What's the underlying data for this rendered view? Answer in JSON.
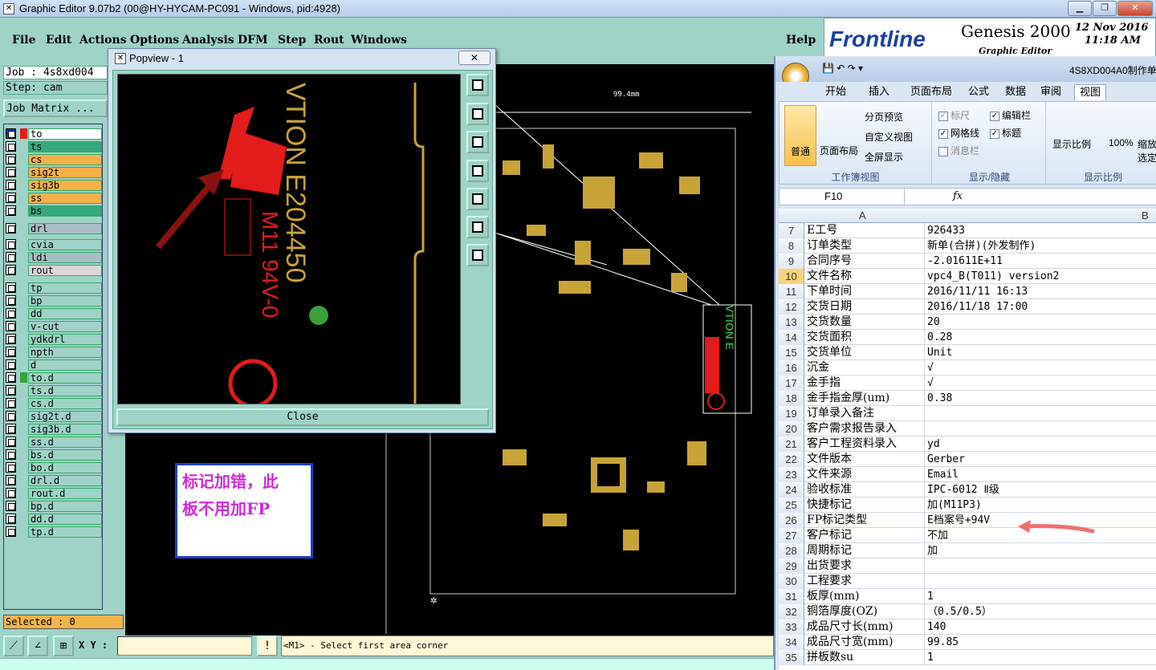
{
  "window": {
    "title": "Graphic Editor 9.07b2 (00@HY-HYCAM-PC091 - Windows, pid:4928)"
  },
  "menu": [
    "File",
    "Edit",
    "Actions",
    "Options",
    "Analysis",
    "DFM",
    "Step",
    "Rout",
    "Windows"
  ],
  "help": "Help",
  "logo": {
    "brand": "Frontline",
    "product": "Genesis 2000",
    "sub": "Graphic Editor",
    "date": "12 Nov 2016",
    "time": "11:18 AM"
  },
  "job": {
    "job": "Job : 4s8xd004",
    "step": "Step: cam",
    "matrix": "Job Matrix ..."
  },
  "layers": [
    {
      "name": "to",
      "bg": "#ffffff",
      "swatch": "#e21b1b",
      "sel": true
    },
    {
      "name": "ts",
      "bg": "#35a87c",
      "swatch": "",
      "sel": false
    },
    {
      "name": "cs",
      "bg": "#f5b04a",
      "swatch": "",
      "sel": false
    },
    {
      "name": "sig2t",
      "bg": "#f5b04a",
      "swatch": "",
      "sel": false
    },
    {
      "name": "sig3b",
      "bg": "#f5b04a",
      "swatch": "",
      "sel": false
    },
    {
      "name": "ss",
      "bg": "#f5b04a",
      "swatch": "",
      "sel": false
    },
    {
      "name": "bs",
      "bg": "#35a87c",
      "swatch": "",
      "sel": false
    },
    {
      "name": "drl",
      "bg": "#a9bec4",
      "swatch": "",
      "sel": false
    },
    {
      "name": "cvia",
      "bg": "#9fd3c7",
      "swatch": "",
      "sel": false
    },
    {
      "name": "ldi",
      "bg": "#a9bec4",
      "swatch": "",
      "sel": false
    },
    {
      "name": "rout",
      "bg": "#d9d9d9",
      "swatch": "",
      "sel": false
    },
    {
      "name": "tp",
      "bg": "#9fd3c7",
      "swatch": "",
      "sel": false
    },
    {
      "name": "bp",
      "bg": "#9fd3c7",
      "swatch": "",
      "sel": false
    },
    {
      "name": "dd",
      "bg": "#9fd3c7",
      "swatch": "",
      "sel": false
    },
    {
      "name": "v-cut",
      "bg": "#9fd3c7",
      "swatch": "",
      "sel": false
    },
    {
      "name": "ydkdrl",
      "bg": "#9fd3c7",
      "swatch": "",
      "sel": false
    },
    {
      "name": "npth",
      "bg": "#9fd3c7",
      "swatch": "",
      "sel": false
    },
    {
      "name": "d",
      "bg": "#9fd3c7",
      "swatch": "",
      "sel": false
    },
    {
      "name": "to.d",
      "bg": "#9fd3c7",
      "swatch": "#3aa03a",
      "sel": false
    },
    {
      "name": "ts.d",
      "bg": "#9fd3c7",
      "swatch": "",
      "sel": false
    },
    {
      "name": "cs.d",
      "bg": "#9fd3c7",
      "swatch": "",
      "sel": false
    },
    {
      "name": "sig2t.d",
      "bg": "#9fd3c7",
      "swatch": "",
      "sel": false
    },
    {
      "name": "sig3b.d",
      "bg": "#9fd3c7",
      "swatch": "",
      "sel": false
    },
    {
      "name": "ss.d",
      "bg": "#9fd3c7",
      "swatch": "",
      "sel": false
    },
    {
      "name": "bs.d",
      "bg": "#9fd3c7",
      "swatch": "",
      "sel": false
    },
    {
      "name": "bo.d",
      "bg": "#9fd3c7",
      "swatch": "",
      "sel": false
    },
    {
      "name": "drl.d",
      "bg": "#9fd3c7",
      "swatch": "",
      "sel": false
    },
    {
      "name": "rout.d",
      "bg": "#9fd3c7",
      "swatch": "",
      "sel": false
    },
    {
      "name": "bp.d",
      "bg": "#9fd3c7",
      "swatch": "",
      "sel": false
    },
    {
      "name": "dd.d",
      "bg": "#9fd3c7",
      "swatch": "",
      "sel": false
    },
    {
      "name": "tp.d",
      "bg": "#9fd3c7",
      "swatch": "",
      "sel": false
    }
  ],
  "selected": "Selected : 0",
  "popview": {
    "title": "Popview - 1",
    "close": "Close",
    "marking_text": "VTION E204450",
    "marking_line2": "M11 94V-0"
  },
  "canvas": {
    "dim": "99.4mm",
    "board_mark": "VTION E"
  },
  "note": {
    "line1": "标记加错，此",
    "line2": "板不用加FP"
  },
  "bottom": {
    "xy_label": "X Y :",
    "prompt": "<M1> - Select first area corner"
  },
  "excel": {
    "title": "4S8XD004A0制作单",
    "tabs": [
      "开始",
      "插入",
      "页面布局",
      "公式",
      "数据",
      "审阅",
      "视图"
    ],
    "active_tab": "视图",
    "ribbon": {
      "normal": "普通",
      "page_layout": "页面布局",
      "page_break": "分页预览",
      "custom_view": "自定义视图",
      "full_screen": "全屏显示",
      "group1": "工作簿视图",
      "ruler": "标尺",
      "formula_bar": "编辑栏",
      "gridlines": "网格线",
      "headings": "标题",
      "message_bar": "消息栏",
      "group2": "显示/隐藏",
      "zoom": "显示比例",
      "zoom100": "100%",
      "zoom_sel": "缩放到选定区域",
      "group3": "显示比例"
    },
    "namebox": "F10",
    "fx": "fx",
    "col_a": "A",
    "col_b": "B",
    "rows": [
      {
        "n": "7",
        "a": "E工号",
        "b": "926433"
      },
      {
        "n": "8",
        "a": "订单类型",
        "b": "新单(合拼)(外发制作)"
      },
      {
        "n": "9",
        "a": "合同序号",
        "b": "-2.01611E+11"
      },
      {
        "n": "10",
        "a": "文件名称",
        "b": "vpc4_B(T011) version2"
      },
      {
        "n": "11",
        "a": "下单时间",
        "b": "2016/11/11 16:13"
      },
      {
        "n": "12",
        "a": "交货日期",
        "b": "2016/11/18 17:00"
      },
      {
        "n": "13",
        "a": "交货数量",
        "b": "20"
      },
      {
        "n": "14",
        "a": "交货面积",
        "b": "0.28"
      },
      {
        "n": "15",
        "a": "交货单位",
        "b": "Unit"
      },
      {
        "n": "16",
        "a": "沉金",
        "b": "√"
      },
      {
        "n": "17",
        "a": "金手指",
        "b": "√"
      },
      {
        "n": "18",
        "a": "金手指金厚(um)",
        "b": "0.38"
      },
      {
        "n": "19",
        "a": "订单录入备注",
        "b": ""
      },
      {
        "n": "20",
        "a": "客户需求报告录入",
        "b": ""
      },
      {
        "n": "21",
        "a": "客户工程资料录入",
        "b": "yd"
      },
      {
        "n": "22",
        "a": "文件版本",
        "b": "Gerber"
      },
      {
        "n": "23",
        "a": "文件来源",
        "b": "Email"
      },
      {
        "n": "24",
        "a": "验收标准",
        "b": "IPC-6012 Ⅱ级"
      },
      {
        "n": "25",
        "a": "快捷标记",
        "b": "加(M11P3)"
      },
      {
        "n": "26",
        "a": "FP标记类型",
        "b": "E档案号+94V"
      },
      {
        "n": "27",
        "a": "客户标记",
        "b": "不加"
      },
      {
        "n": "28",
        "a": "周期标记",
        "b": "加"
      },
      {
        "n": "29",
        "a": "出货要求",
        "b": ""
      },
      {
        "n": "30",
        "a": "工程要求",
        "b": ""
      },
      {
        "n": "31",
        "a": "板厚(mm)",
        "b": "1"
      },
      {
        "n": "32",
        "a": "铜箔厚度(OZ)",
        "b": "（0.5/0.5）"
      },
      {
        "n": "33",
        "a": "成品尺寸长(mm)",
        "b": "140"
      },
      {
        "n": "34",
        "a": "成品尺寸宽(mm)",
        "b": "99.85"
      },
      {
        "n": "35",
        "a": "拼板数su",
        "b": "1"
      }
    ]
  }
}
